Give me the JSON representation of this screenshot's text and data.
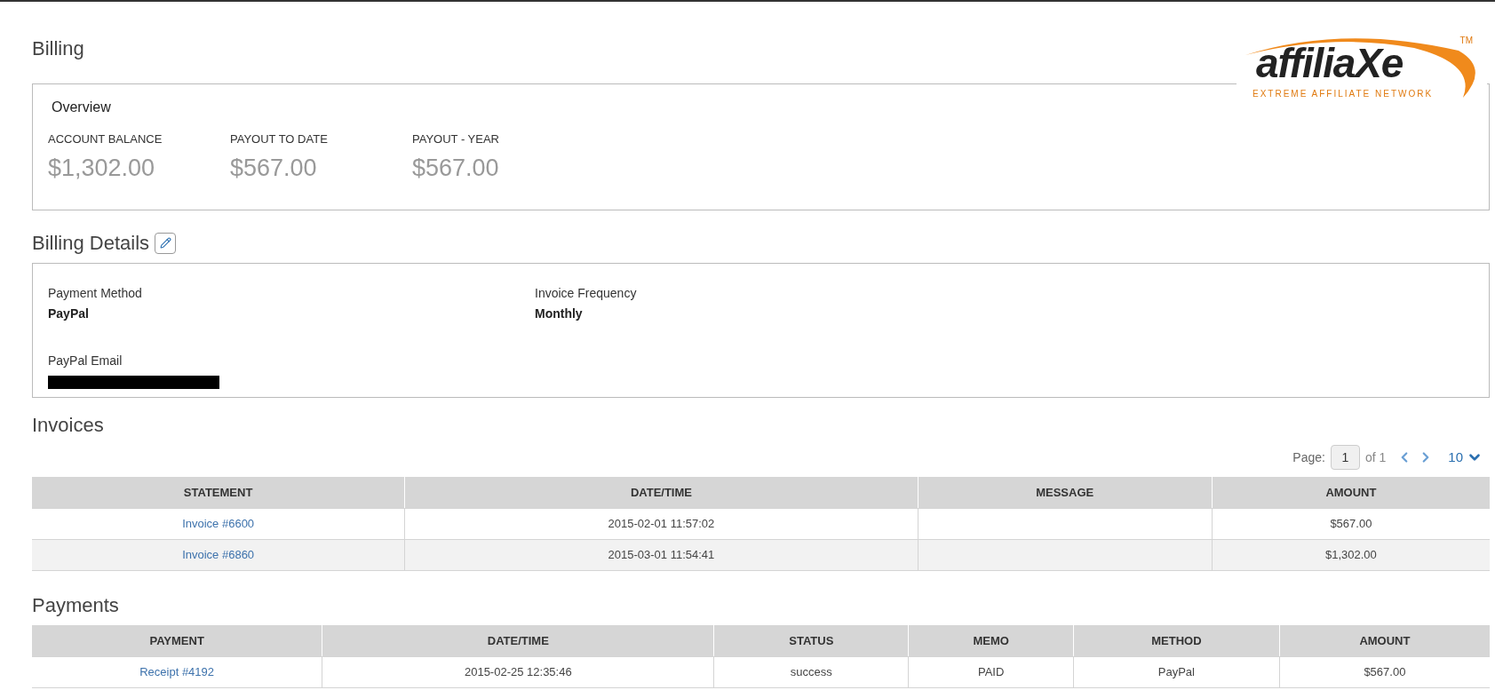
{
  "logo": {
    "word": "affiliaXe",
    "trademark": "TM",
    "tagline": "EXTREME AFFILIATE NETWORK"
  },
  "title": "Billing",
  "overview": {
    "title": "Overview",
    "stats": [
      {
        "label": "ACCOUNT BALANCE",
        "value": "$1,302.00"
      },
      {
        "label": "PAYOUT TO DATE",
        "value": "$567.00"
      },
      {
        "label": "PAYOUT - YEAR",
        "value": "$567.00"
      }
    ]
  },
  "billing_details": {
    "title": "Billing Details",
    "fields": [
      {
        "label": "Payment Method",
        "value": "PayPal"
      },
      {
        "label": "Invoice Frequency",
        "value": "Monthly"
      },
      {
        "label": "PayPal Email",
        "redacted": true
      }
    ]
  },
  "invoices": {
    "title": "Invoices",
    "pager": {
      "label": "Page:",
      "page": "1",
      "of": "of 1",
      "per_page": "10"
    },
    "columns": [
      "STATEMENT",
      "DATE/TIME",
      "MESSAGE",
      "AMOUNT"
    ],
    "rows": [
      [
        "Invoice #6600",
        "2015-02-01 11:57:02",
        "",
        "$567.00"
      ],
      [
        "Invoice #6860",
        "2015-03-01 11:54:41",
        "",
        "$1,302.00"
      ]
    ]
  },
  "payments": {
    "title": "Payments",
    "columns": [
      "PAYMENT",
      "DATE/TIME",
      "STATUS",
      "MEMO",
      "METHOD",
      "AMOUNT"
    ],
    "rows": [
      [
        "Receipt #4192",
        "2015-02-25 12:35:46",
        "success",
        "PAID",
        "PayPal",
        "$567.00"
      ]
    ]
  }
}
